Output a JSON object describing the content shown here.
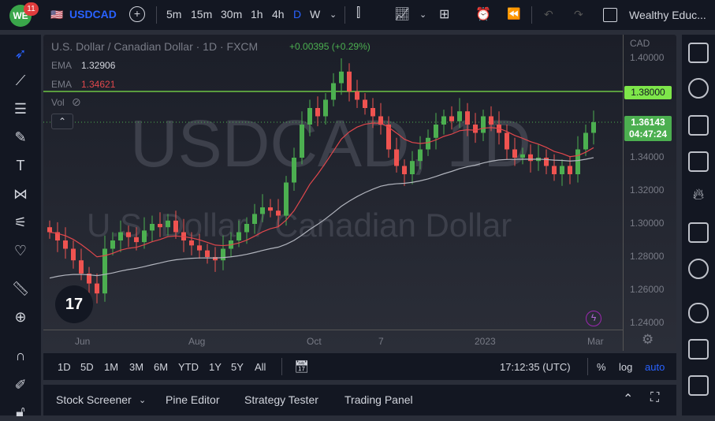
{
  "topbar": {
    "logo": "WE",
    "notifications": "11",
    "symbol": "USDCAD",
    "intervals": [
      "5m",
      "15m",
      "30m",
      "1h",
      "4h",
      "D",
      "W"
    ],
    "active_interval": "D",
    "layout_name": "Wealthy Educ..."
  },
  "chart": {
    "title": "U.S. Dollar / Canadian Dollar · 1D · FXCM",
    "change": "+0.00395 (+0.29%)",
    "ema1_label": "EMA",
    "ema1_value": "1.32906",
    "ema2_label": "EMA",
    "ema2_value": "1.34621",
    "vol_label": "Vol",
    "watermark_symbol": "USDCAD, 1D",
    "watermark_name": "U.S. Dollar / Canadian Dollar",
    "currency": "CAD",
    "line_price": "1.38000",
    "last_price": "1.36143",
    "countdown": "04:47:24",
    "colors": {
      "up": "#26a69a",
      "down": "#ef5350",
      "candle_up": "#4caf50",
      "line": "#7ee64a",
      "ema_fast": "#e0474c",
      "ema_slow": "#b2b5be"
    }
  },
  "time_axis": [
    "Jun",
    "Aug",
    "Oct",
    "7",
    "2023",
    "Mar"
  ],
  "bottom": {
    "ranges": [
      "1D",
      "5D",
      "1M",
      "3M",
      "6M",
      "YTD",
      "1Y",
      "5Y",
      "All"
    ],
    "clock": "17:12:35 (UTC)",
    "pct": "%",
    "log": "log",
    "auto": "auto"
  },
  "panel": {
    "tabs": [
      "Stock Screener",
      "Pine Editor",
      "Strategy Tester",
      "Trading Panel"
    ]
  },
  "chart_data": {
    "type": "candlestick",
    "title": "U.S. Dollar / Canadian Dollar · 1D · FXCM",
    "ylim": [
      1.235,
      1.41
    ],
    "yticks": [
      "1.40000",
      "1.34000",
      "1.32000",
      "1.30000",
      "1.28000",
      "1.26000",
      "1.24000"
    ],
    "ytick_values": [
      1.4,
      1.34,
      1.32,
      1.3,
      1.28,
      1.26,
      1.24
    ],
    "horizontal_line": 1.38,
    "closes": [
      1.295,
      1.29,
      1.285,
      1.278,
      1.27,
      1.264,
      1.258,
      1.285,
      1.29,
      1.295,
      1.292,
      1.289,
      1.296,
      1.3,
      1.298,
      1.302,
      1.295,
      1.29,
      1.287,
      1.284,
      1.28,
      1.278,
      1.285,
      1.29,
      1.295,
      1.3,
      1.306,
      1.31,
      1.308,
      1.305,
      1.325,
      1.34,
      1.36,
      1.37,
      1.365,
      1.375,
      1.385,
      1.392,
      1.38,
      1.375,
      1.37,
      1.365,
      1.36,
      1.345,
      1.335,
      1.33,
      1.338,
      1.345,
      1.352,
      1.36,
      1.365,
      1.362,
      1.368,
      1.36,
      1.355,
      1.365,
      1.36,
      1.355,
      1.345,
      1.34,
      1.342,
      1.338,
      1.34,
      1.335,
      1.33,
      1.335,
      1.33,
      1.345,
      1.355,
      1.36143
    ]
  }
}
